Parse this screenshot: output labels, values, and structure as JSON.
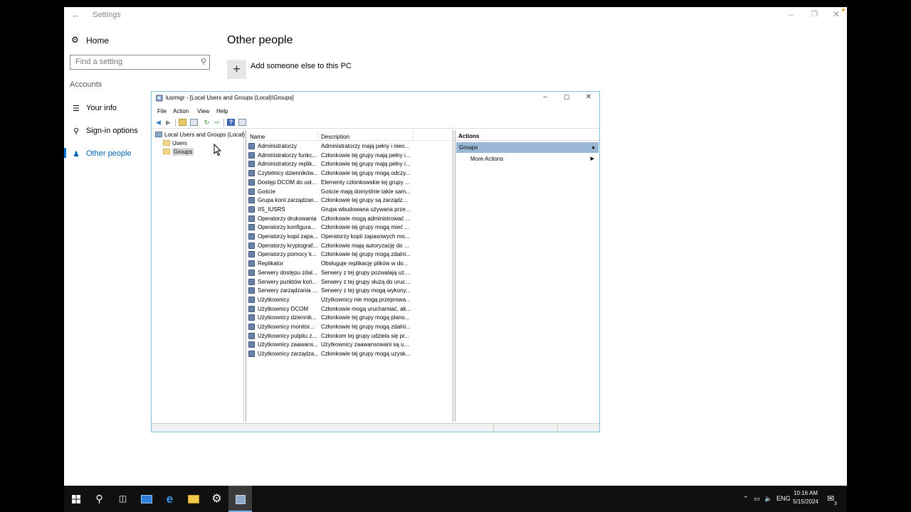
{
  "settings": {
    "title": "Settings",
    "home_label": "Home",
    "search_placeholder": "Find a setting",
    "section_label": "Accounts",
    "nav": [
      {
        "label": "Your info",
        "icon": "person-card-icon"
      },
      {
        "label": "Sign-in options",
        "icon": "key-icon"
      },
      {
        "label": "Other people",
        "icon": "people-icon",
        "active": true
      }
    ],
    "page_title": "Other people",
    "add_label": "Add someone else to this PC"
  },
  "mmc": {
    "title": "lusrmgr - [Local Users and Groups (Local)\\Groups]",
    "menu": [
      "File",
      "Action",
      "View",
      "Help"
    ],
    "tree": {
      "root": "Local Users and Groups (Local)",
      "children": [
        "Users",
        "Groups"
      ],
      "selected": "Groups"
    },
    "columns": {
      "name": "Name",
      "description": "Description"
    },
    "rows": [
      {
        "name": "Administratorzy",
        "description": "Administratorzy mają pełny i nieo..."
      },
      {
        "name": "Administratorzy funkc...",
        "description": "Członkowie tej grupy mają pełny i..."
      },
      {
        "name": "Administratorzy replik...",
        "description": "Członkowie tej grupy mają pełny i..."
      },
      {
        "name": "Czytelnicy dzienników...",
        "description": "Członkowie tej grupy mogą odczy..."
      },
      {
        "name": "Dostęp DCOM do usł...",
        "description": "Elementy członkowskie tej grupy ..."
      },
      {
        "name": "Goście",
        "description": "Goście mają domyślnie takie sam..."
      },
      {
        "name": "Grupa kont zarządzan...",
        "description": "Członkowie tej grupy są zarządzan..."
      },
      {
        "name": "IIS_IUSRS",
        "description": "Grupa wbudowana używana przez..."
      },
      {
        "name": "Operatorzy drukowania",
        "description": "Członkowie mogą administrować ..."
      },
      {
        "name": "Operatorzy konfigura...",
        "description": "Członkowie tej grupy mogą mieć ..."
      },
      {
        "name": "Operatorzy kopii zapa...",
        "description": "Operatorzy kopii zapasowych mo..."
      },
      {
        "name": "Operatorzy kryptograf...",
        "description": "Członkowie mają autoryzację do ..."
      },
      {
        "name": "Operatorzy pomocy k...",
        "description": "Członkowie tej grupy mogą zdalni..."
      },
      {
        "name": "Replikator",
        "description": "Obsługuje replikację plików w do..."
      },
      {
        "name": "Serwery dostępu zdal...",
        "description": "Serwery z tej grupy pozwalają użyt..."
      },
      {
        "name": "Serwery punktów koń...",
        "description": "Serwery z tej grupy służą do uruch..."
      },
      {
        "name": "Serwery zarządzania R...",
        "description": "Serwery z tej grupy mogą wykony..."
      },
      {
        "name": "Użytkownicy",
        "description": "Użytkownicy nie mogą przeprowa..."
      },
      {
        "name": "Użytkownicy DCOM",
        "description": "Członkowie mogą uruchamiać, ak..."
      },
      {
        "name": "Użytkownicy dziennik...",
        "description": "Członkowie tej grupy mogą plano..."
      },
      {
        "name": "Użytkownicy monitor...",
        "description": "Członkowie tej grupy mogą zdalni..."
      },
      {
        "name": "Użytkownicy pulpitu z...",
        "description": "Członkom tej grupy udziela się pr..."
      },
      {
        "name": "Użytkownicy zaawans...",
        "description": "Użytkownicy zaawansowani są uw..."
      },
      {
        "name": "Użytkownicy zarządza...",
        "description": "Członkowie tej grupy mogą uzysk..."
      }
    ],
    "actions": {
      "header": "Actions",
      "group": "Groups",
      "more": "More Actions"
    }
  },
  "taskbar": {
    "language": "ENG",
    "time": "10:16 AM",
    "date": "5/15/2024",
    "notification_count": "3"
  }
}
